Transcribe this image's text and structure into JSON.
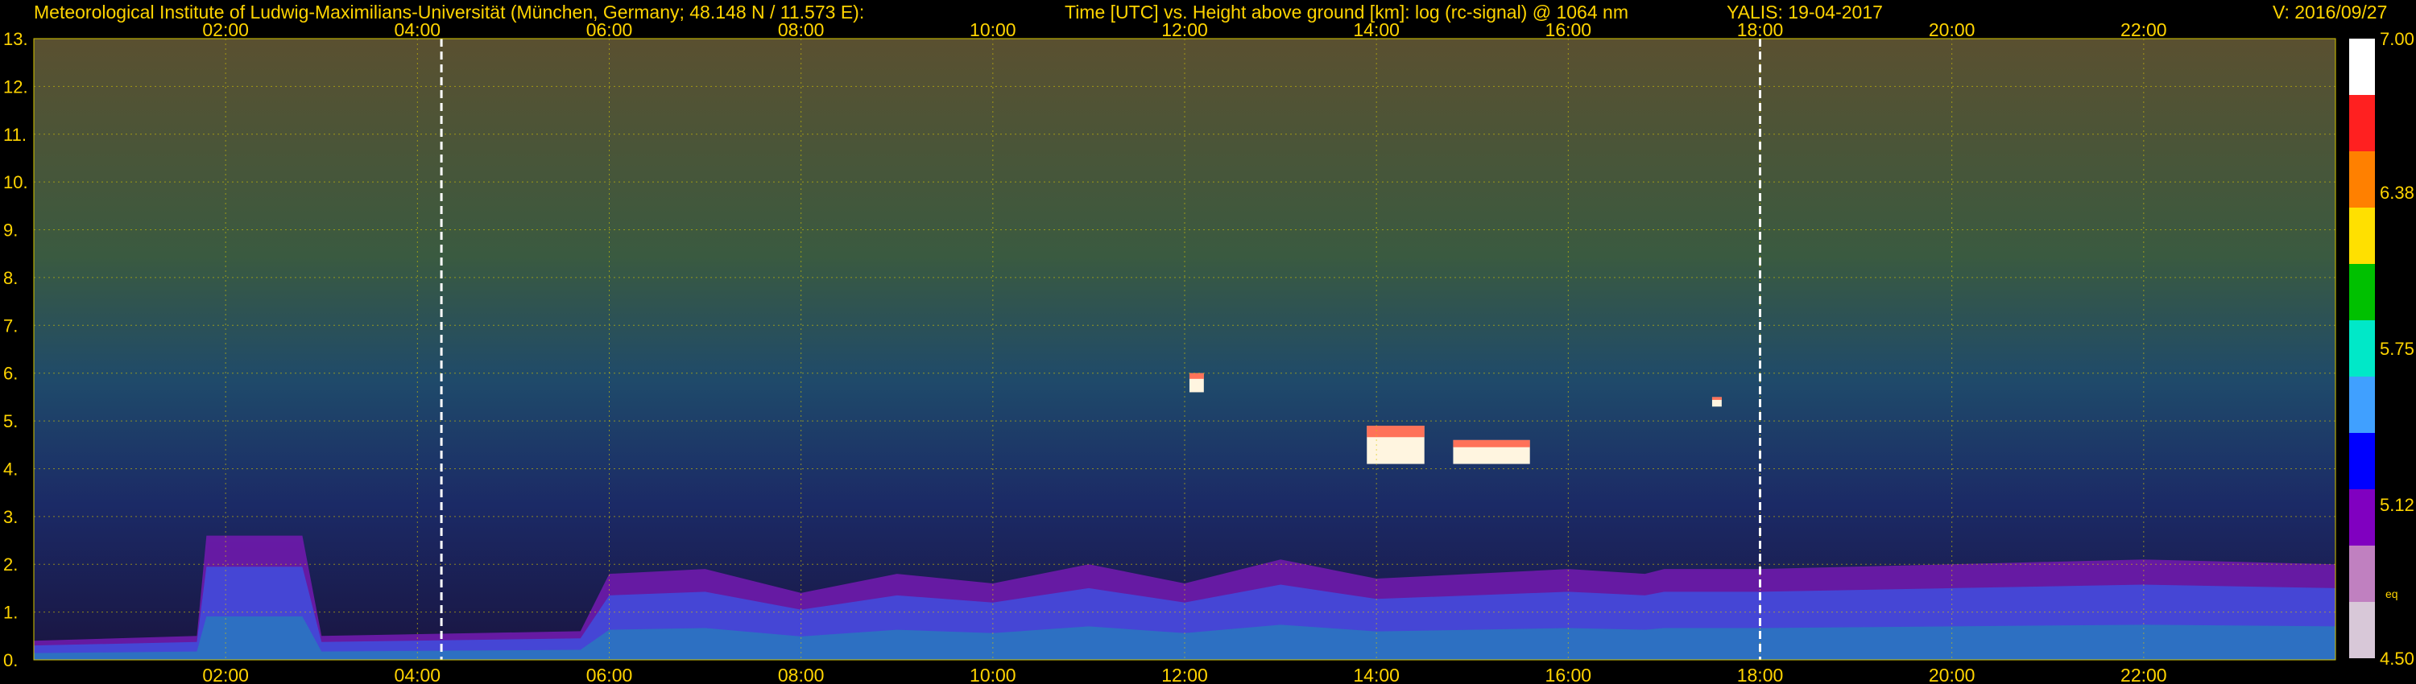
{
  "header": {
    "institute": "Meteorological Institute of Ludwig-Maximilians-Universität (München, Germany; 48.148 N / 11.573 E):",
    "plot_title": "Time [UTC] vs. Height above ground [km]: log (rc-signal) @ 1064 nm",
    "instrument": "YALIS: 19-04-2017",
    "version": "V: 2016/09/27"
  },
  "colors": {
    "background": "#000000",
    "label": "#ffd400",
    "grid": "#d8c800",
    "marker": "#ffffff"
  },
  "chart_data": {
    "type": "heatmap",
    "title": "Time [UTC] vs. Height above ground [km]: log (rc-signal) @ 1064 nm",
    "xlabel": "Time [UTC]",
    "ylabel": "Height above ground [km]",
    "x_unit": "hour UTC",
    "xlim": [
      0,
      24
    ],
    "ylim": [
      0,
      13
    ],
    "x_ticks": [
      2,
      4,
      6,
      8,
      10,
      12,
      14,
      16,
      18,
      20,
      22
    ],
    "x_tick_labels": [
      "02:00",
      "04:00",
      "06:00",
      "08:00",
      "10:00",
      "12:00",
      "14:00",
      "16:00",
      "18:00",
      "20:00",
      "22:00"
    ],
    "y_ticks": [
      0,
      1,
      2,
      3,
      4,
      5,
      6,
      7,
      8,
      9,
      10,
      11,
      12,
      13
    ],
    "y_tick_labels": [
      "0.",
      "1.",
      "2.",
      "3.",
      "4.",
      "5.",
      "6.",
      "7.",
      "8.",
      "9.",
      "10.",
      "11.",
      "12.",
      "13."
    ],
    "grid": true,
    "marker_times": [
      4.25,
      18.0
    ],
    "colorbar": {
      "range": [
        4.5,
        7.0
      ],
      "tick_values": [
        7.0,
        6.38,
        5.75,
        5.12,
        4.5
      ],
      "tick_labels": [
        "7.00",
        "6.38",
        "5.75",
        "5.12",
        "4.50"
      ],
      "extra_label": "eq",
      "colors": [
        "#ffffff",
        "#ff2020",
        "#ff8000",
        "#ffe000",
        "#00c000",
        "#00e8c8",
        "#40a0ff",
        "#0000ff",
        "#8000c0",
        "#c080c0",
        "#d8c8d8"
      ]
    },
    "boundary_layer_top_km": [
      {
        "t": 0.0,
        "h": 0.4
      },
      {
        "t": 1.7,
        "h": 0.5
      },
      {
        "t": 1.8,
        "h": 2.6
      },
      {
        "t": 2.8,
        "h": 2.6
      },
      {
        "t": 3.0,
        "h": 0.5
      },
      {
        "t": 5.7,
        "h": 0.6
      },
      {
        "t": 6.0,
        "h": 1.8
      },
      {
        "t": 7.0,
        "h": 1.9
      },
      {
        "t": 8.0,
        "h": 1.4
      },
      {
        "t": 9.0,
        "h": 1.8
      },
      {
        "t": 10.0,
        "h": 1.6
      },
      {
        "t": 11.0,
        "h": 2.0
      },
      {
        "t": 12.0,
        "h": 1.6
      },
      {
        "t": 13.0,
        "h": 2.1
      },
      {
        "t": 14.0,
        "h": 1.7
      },
      {
        "t": 15.0,
        "h": 1.8
      },
      {
        "t": 16.0,
        "h": 1.9
      },
      {
        "t": 16.8,
        "h": 1.8
      },
      {
        "t": 17.0,
        "h": 1.9
      },
      {
        "t": 18.0,
        "h": 1.9
      },
      {
        "t": 20.0,
        "h": 2.0
      },
      {
        "t": 22.0,
        "h": 2.1
      },
      {
        "t": 24.0,
        "h": 2.0
      }
    ],
    "cloud_patches": [
      {
        "t0": 12.05,
        "t1": 12.2,
        "h0": 5.6,
        "h1": 6.0
      },
      {
        "t0": 13.9,
        "t1": 14.5,
        "h0": 4.1,
        "h1": 4.9
      },
      {
        "t0": 14.8,
        "t1": 15.6,
        "h0": 4.1,
        "h1": 4.6
      },
      {
        "t0": 17.5,
        "t1": 17.6,
        "h0": 5.3,
        "h1": 5.5
      }
    ]
  }
}
